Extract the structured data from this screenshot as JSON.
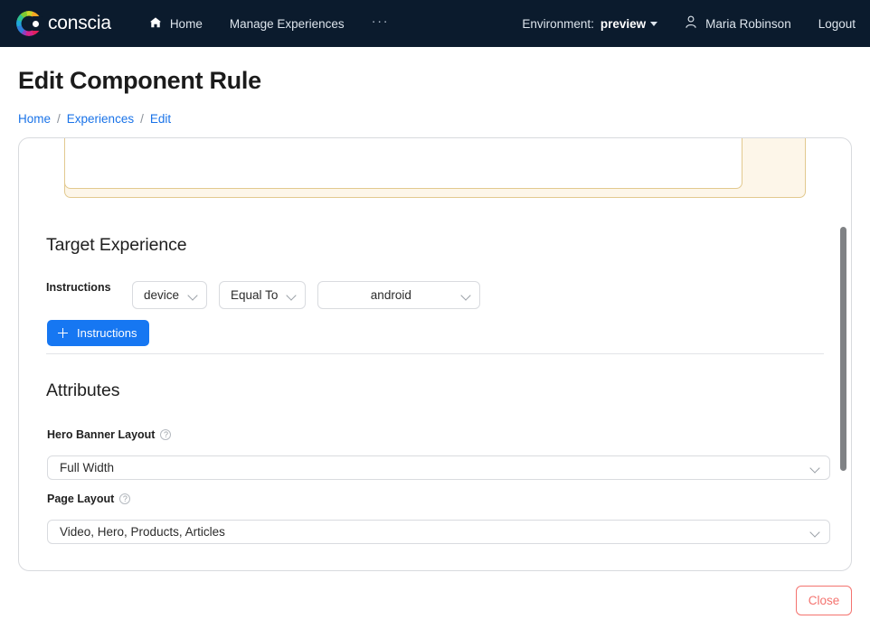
{
  "navbar": {
    "brand": {
      "name": "conscia",
      "logo_icon": "conscia-ring-logo"
    },
    "links": [
      {
        "label": "Home",
        "icon": "home-icon"
      },
      {
        "label": "Manage Experiences",
        "icon": ""
      }
    ],
    "overflow_label": "···",
    "environment": {
      "label": "Environment:",
      "value": "preview"
    },
    "user": {
      "name": "Maria Robinson",
      "icon": "user-icon"
    },
    "logout_label": "Logout",
    "background_color": "#0b1b2d"
  },
  "page": {
    "title": "Edit Component Rule",
    "breadcrumb": [
      "Home",
      "Experiences",
      "Edit"
    ],
    "breadcrumb_separator": "/",
    "link_color": "#1a73e8"
  },
  "condition": {
    "field": "device",
    "operator": "Equal To",
    "value": "android",
    "chevron_icon": "chevron-down-icon",
    "group_background": "#fdf6e9",
    "group_border": "#e2c98f"
  },
  "target_experience": {
    "title": "Target Experience",
    "instructions_label": "Instructions",
    "add_button_label": "Instructions",
    "add_button_icon": "plus-icon",
    "add_button_color": "#1677f2"
  },
  "attributes": {
    "title": "Attributes",
    "fields": [
      {
        "label": "Hero Banner Layout",
        "help_icon": "question-mark-circle-icon",
        "value": "Full Width",
        "chevron_icon": "chevron-down-icon"
      },
      {
        "label": "Page Layout",
        "help_icon": "question-mark-circle-icon",
        "value": "Video, Hero, Products, Articles",
        "chevron_icon": "chevron-down-icon"
      }
    ]
  },
  "footer": {
    "close_label": "Close",
    "close_color": "#f4736f"
  }
}
